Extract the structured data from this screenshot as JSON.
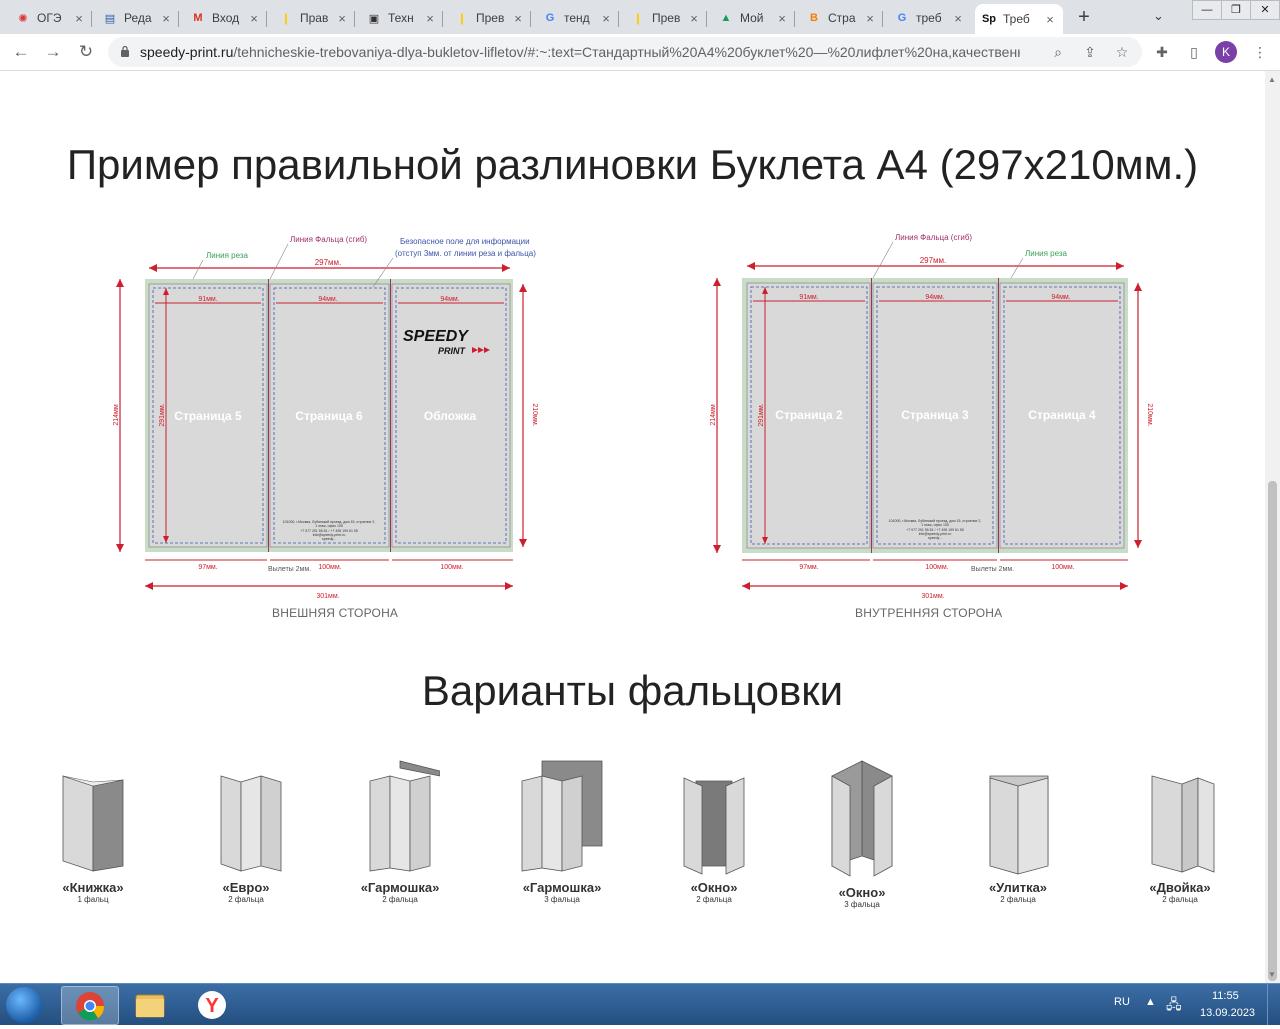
{
  "browser": {
    "tabs": [
      {
        "title": "ОГЭ",
        "icon": "fipi-icon"
      },
      {
        "title": "Реда",
        "icon": "editor-icon"
      },
      {
        "title": "Вход",
        "icon": "gmail-icon"
      },
      {
        "title": "Прав",
        "icon": "yandex-icon"
      },
      {
        "title": "Техн",
        "icon": "printer-icon"
      },
      {
        "title": "Прев",
        "icon": "yandex-icon"
      },
      {
        "title": "тенд",
        "icon": "google-icon"
      },
      {
        "title": "Прев",
        "icon": "yandex-icon"
      },
      {
        "title": "Мой",
        "icon": "drive-icon"
      },
      {
        "title": "Стра",
        "icon": "blogger-icon"
      },
      {
        "title": "треб",
        "icon": "google-icon"
      },
      {
        "title": "Треб",
        "icon": "speedy-icon",
        "active": true
      }
    ],
    "active_favicon_text": "Sp",
    "url_host": "speedy-print.ru",
    "url_rest": "/tehnicheskie-trebovaniya-dlya-bukletov-lifletov/#:~:text=Стандартный%20А4%20буклет%20—%20лифлет%20на,качественн...",
    "profile_initial": "K"
  },
  "page": {
    "title": "Пример правильной разлиновки Буклета А4 (297х210мм.)",
    "outer": {
      "caption": "ВНЕШНЯЯ СТОРОНА",
      "label_cut": "Линия реза",
      "label_fold": "Линия Фальца (сгиб)",
      "label_safe_1": "Безопасное поле для информации",
      "label_safe_2": "(отступ 3мм. от линии реза и фальца)",
      "dim_top": "297мм.",
      "dim_cols": [
        "91мм.",
        "94мм.",
        "94мм."
      ],
      "dim_left": "214мм",
      "dim_inner_left": "291мм.",
      "dim_right": "210мм.",
      "panels": [
        "Страница 5",
        "Страница 6",
        "Обложка"
      ],
      "dim_bottom": [
        "97мм.",
        "100мм.",
        "100мм."
      ],
      "bleed": "Вылеты 2мм.",
      "dim_total": "301мм.",
      "logo_1": "SPEEDY",
      "logo_2": "PRINT",
      "address": [
        "101000, г.Москва, Лубянский проезд, дом 15, строение 2,",
        "1 этаж, офис 105",
        "+7 977 291 55 81 / +7 495 199 61 55",
        "info@speedy-print.ru",
        "speedy..."
      ]
    },
    "inner": {
      "caption": "ВНУТРЕННЯЯ СТОРОНА",
      "label_fold": "Линия Фальца (сгиб)",
      "label_cut": "Линия реза",
      "dim_top": "297мм.",
      "dim_cols": [
        "91мм.",
        "94мм.",
        "94мм."
      ],
      "dim_left": "214мм",
      "dim_inner_left": "291мм.",
      "dim_right": "210мм.",
      "panels": [
        "Страница 2",
        "Страница 3",
        "Страница 4"
      ],
      "dim_bottom": [
        "97мм.",
        "100мм.",
        "100мм."
      ],
      "bleed": "Вылеты 2мм.",
      "dim_total": "301мм.",
      "address": [
        "101000, г.Москва, Лубянский проезд, дом 15, строение 2,",
        "1 этаж, офис 105",
        "+7 977 291 55 81 / +7 495 199 61 55",
        "info@speedy-print.ru",
        "speedy..."
      ]
    },
    "folds_title": "Варианты фальцовки",
    "folds": [
      {
        "name": "«Книжка»",
        "count": "1 фальц"
      },
      {
        "name": "«Евро»",
        "count": "2 фальца"
      },
      {
        "name": "«Гармошка»",
        "count": "2 фальца"
      },
      {
        "name": "«Гармошка»",
        "count": "3 фальца"
      },
      {
        "name": "«Окно»",
        "count": "2 фальца"
      },
      {
        "name": "«Окно»",
        "count": "3 фальца"
      },
      {
        "name": "«Улитка»",
        "count": "2 фальца"
      },
      {
        "name": "«Двойка»",
        "count": "2 фальца"
      }
    ]
  },
  "taskbar": {
    "lang": "RU",
    "time": "11:55",
    "date": "13.09.2023"
  },
  "colors": {
    "dimension_red": "#cc1f2f",
    "fold_magenta": "#a0306a",
    "cut_green": "#3aa05a",
    "safe_blue": "#3a55a8",
    "panel_gray": "#d9d9d9",
    "bleed_green": "#c8dcc8"
  }
}
